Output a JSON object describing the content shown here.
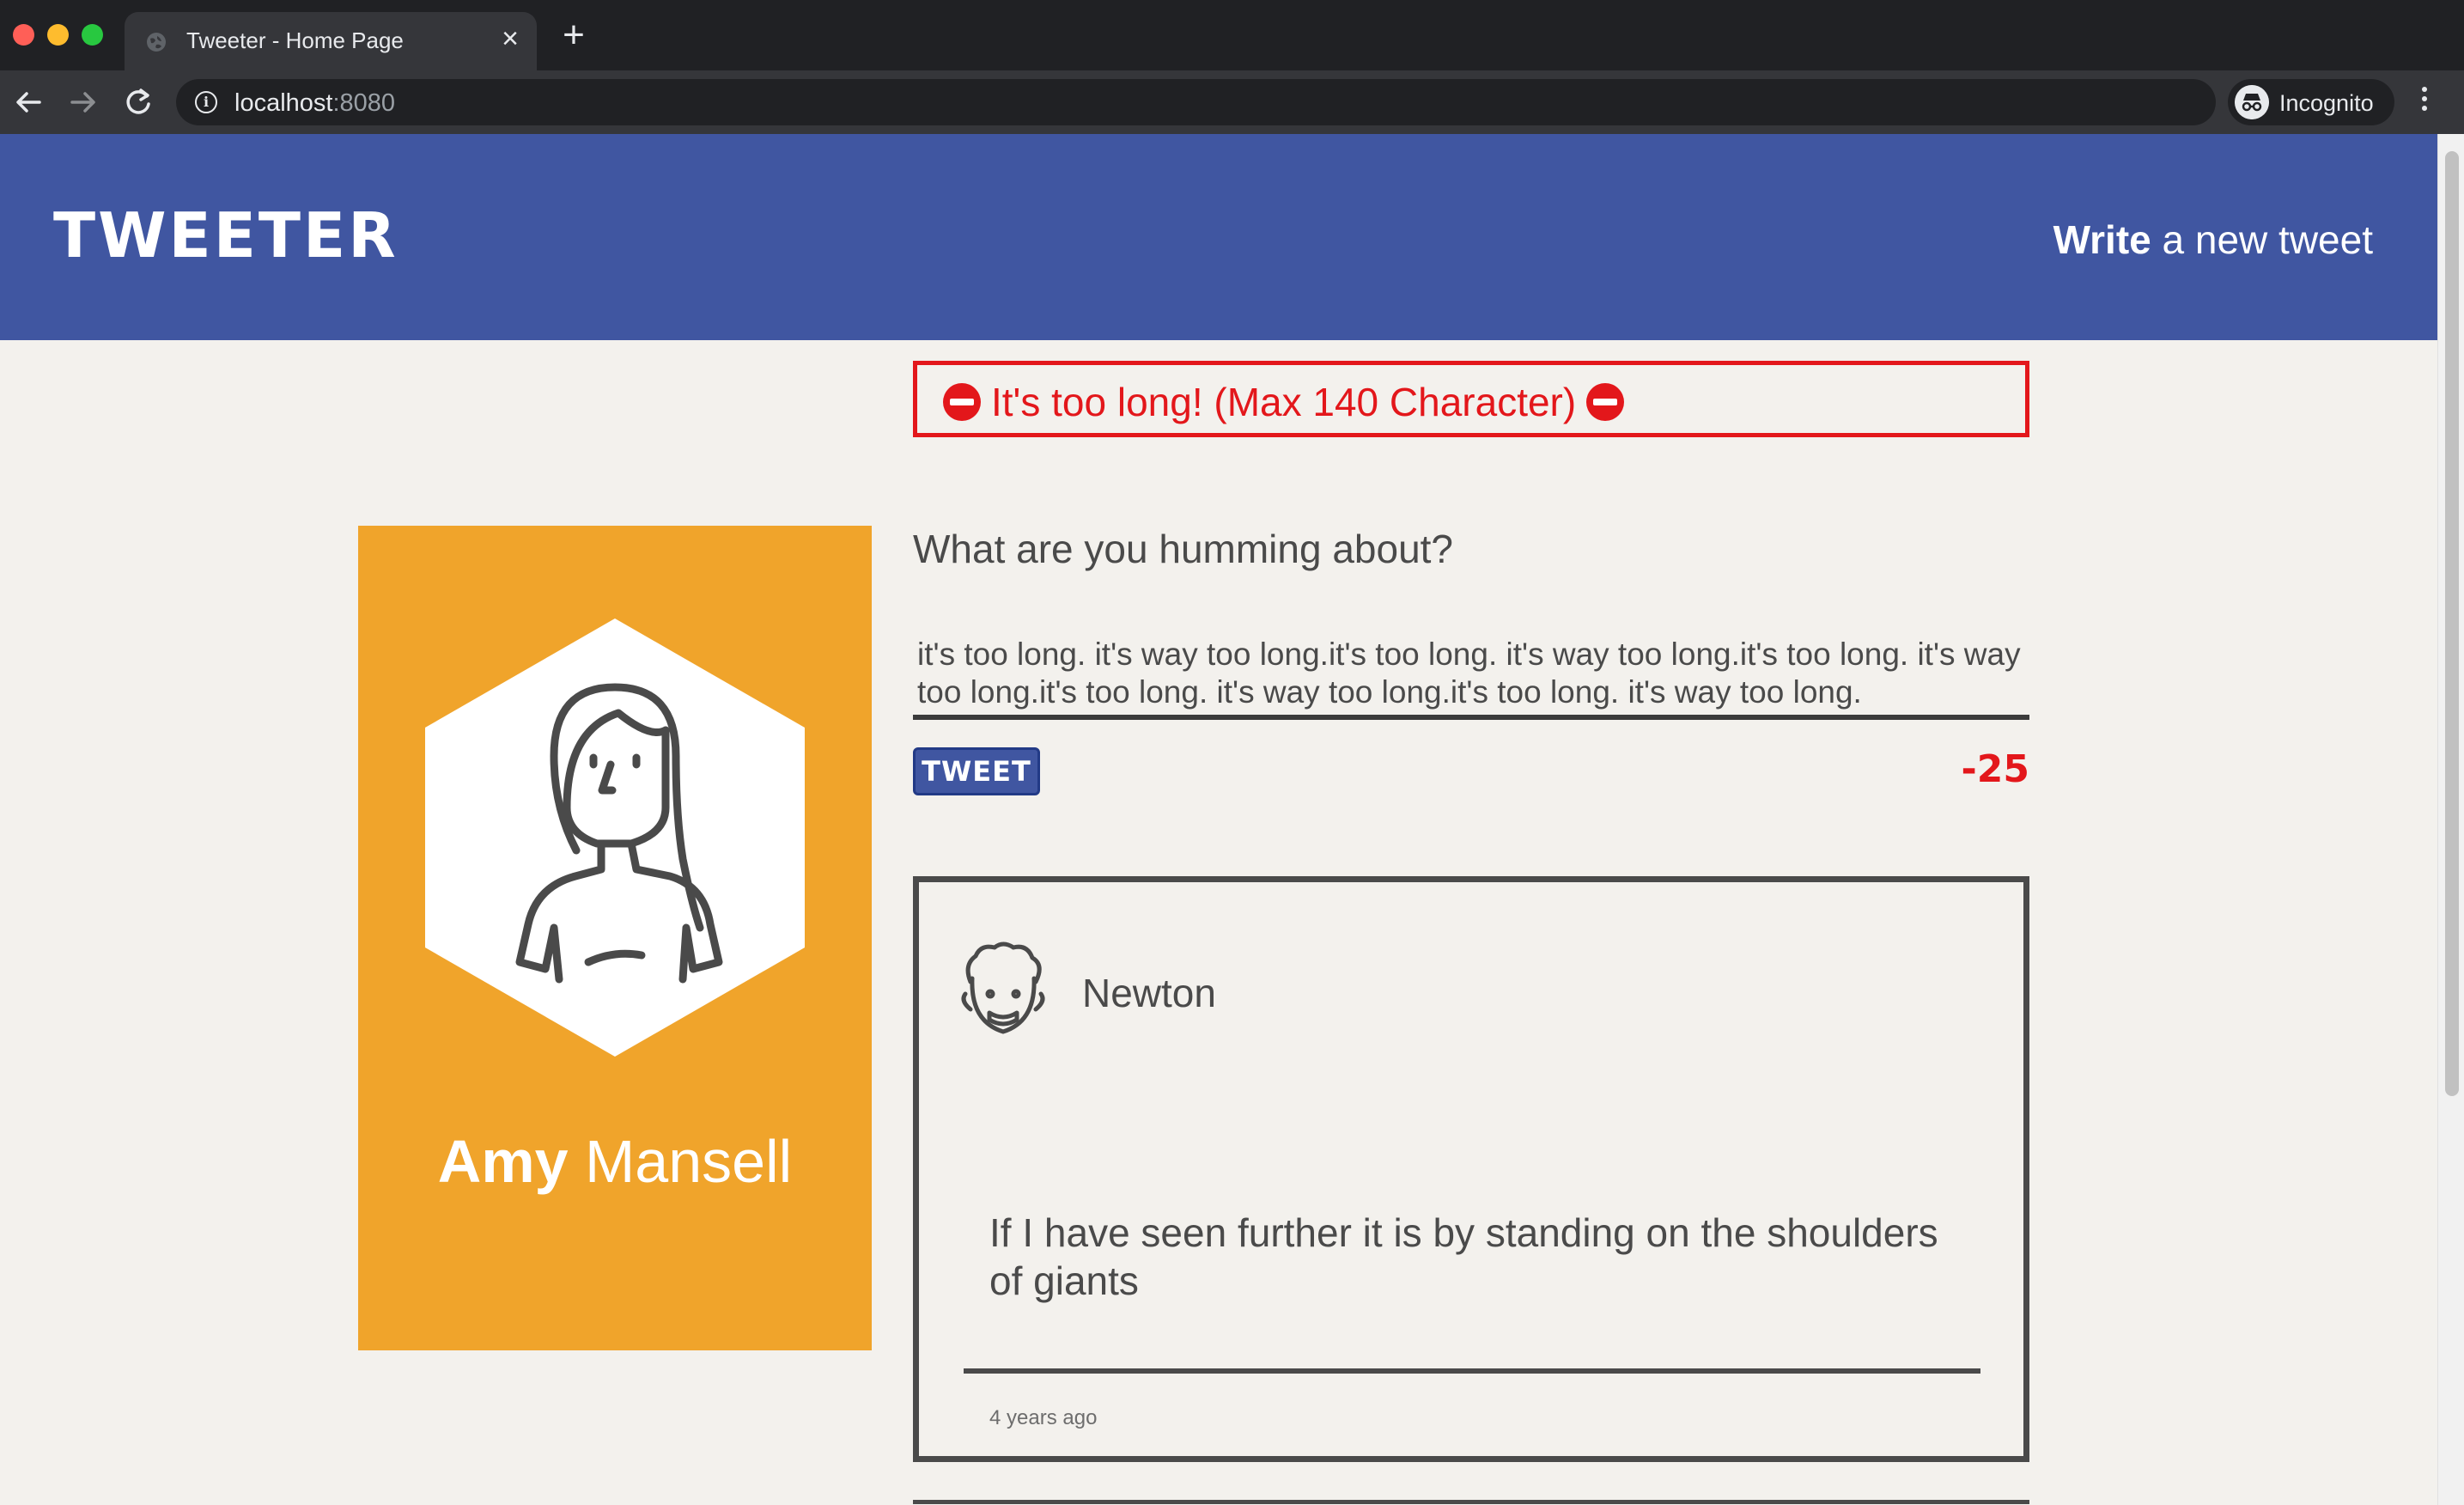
{
  "browser": {
    "tab_title": "Tweeter - Home Page",
    "tab_close": "×",
    "new_tab": "+",
    "url_host": "localhost",
    "url_port": ":8080",
    "incognito_label": "Incognito",
    "icons": {
      "back": "back-arrow-icon",
      "forward": "forward-arrow-icon",
      "reload": "reload-icon",
      "info": "info-icon",
      "bookmark": "star-icon",
      "menu": "kebab-menu-icon"
    },
    "accent_color": "#8ab4f8"
  },
  "header": {
    "logo": "TWEETER",
    "compose_bold": "Write",
    "compose_rest": " a new tweet",
    "background_color": "#4056a1"
  },
  "error": {
    "message": "It's too long! (Max 140 Character)",
    "color": "#e3171b"
  },
  "profile": {
    "first_name": "Amy",
    "last_name": " Mansell",
    "card_color": "#f0a42b"
  },
  "composer": {
    "prompt": "What are you humming about?",
    "text": "it's too long. it's way too long.it's too long. it's way too long.it's too long. it's way too long.it's too long. it's way too long.it's too long. it's way too long.",
    "button_label": "TWEET",
    "counter": "-25"
  },
  "tweets": [
    {
      "author": "Newton",
      "body": "If I have seen further it is by standing on the shoulders of giants",
      "time": "4 years ago"
    }
  ]
}
